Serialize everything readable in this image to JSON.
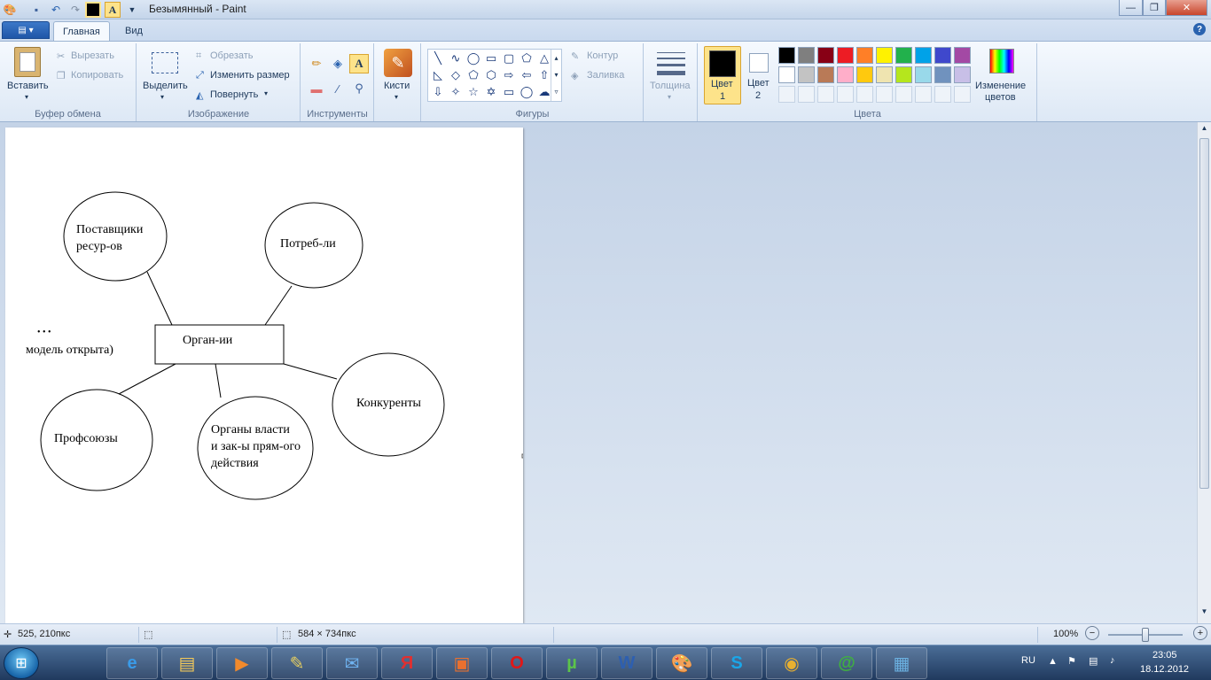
{
  "window": {
    "title": "Безымянный - Paint",
    "minimize_glyph": "—",
    "maximize_glyph": "❐",
    "close_glyph": "✕"
  },
  "tabs": [
    {
      "label": "Главная",
      "active": true
    },
    {
      "label": "Вид",
      "active": false
    }
  ],
  "ribbon": {
    "clipboard": {
      "paste_label": "Вставить",
      "cut_label": "Вырезать",
      "copy_label": "Копировать",
      "group_label": "Буфер обмена"
    },
    "image": {
      "select_label": "Выделить",
      "crop_label": "Обрезать",
      "resize_label": "Изменить размер",
      "rotate_label": "Повернуть",
      "group_label": "Изображение"
    },
    "tools": {
      "group_label": "Инструменты"
    },
    "brushes": {
      "label": "Кисти"
    },
    "shapes": {
      "outline_label": "Контур",
      "fill_label": "Заливка",
      "group_label": "Фигуры"
    },
    "size": {
      "label": "Толщина"
    },
    "colors": {
      "color1_label": "Цвет",
      "color1_num": "1",
      "color2_label": "Цвет",
      "color2_num": "2",
      "edit_label": "Изменение",
      "edit_label2": "цветов",
      "group_label": "Цвета",
      "color1": "#000000",
      "color2": "#ffffff",
      "palette_row1": [
        "#000000",
        "#7f7f7f",
        "#880015",
        "#ed1c24",
        "#ff7f27",
        "#fff200",
        "#22b14c",
        "#00a2e8",
        "#3f48cc",
        "#a349a4"
      ],
      "palette_row2": [
        "#ffffff",
        "#c3c3c3",
        "#b97a57",
        "#ffaec9",
        "#ffc90e",
        "#efe4b0",
        "#b5e61d",
        "#99d9ea",
        "#7092be",
        "#c8bfe7"
      ]
    }
  },
  "diagram": {
    "suppliers": [
      "Поставщики",
      "ресур-ов"
    ],
    "consumers": "Потреб-ли",
    "organization": "Орган-ии",
    "open_model_dots": "• • •",
    "open_model": "модель открыта)",
    "competitors": "Конкуренты",
    "unions": "Профсоюзы",
    "authorities": [
      "Органы власти",
      "и зак-ы прям-ого",
      "действия"
    ]
  },
  "statusbar": {
    "cursor_pos": "525, 210пкс",
    "image_size": "584 × 734пкс",
    "zoom": "100%"
  },
  "taskbar": {
    "apps": [
      {
        "name": "ie-icon",
        "glyph": "e",
        "color": "#3a9be8"
      },
      {
        "name": "explorer-icon",
        "glyph": "▤",
        "color": "#f1c85a"
      },
      {
        "name": "media-player-icon",
        "glyph": "▶",
        "color": "#f28a2c"
      },
      {
        "name": "paint-tool-icon",
        "glyph": "✎",
        "color": "#e8d060"
      },
      {
        "name": "mail-icon",
        "glyph": "✉",
        "color": "#6fb3f0"
      },
      {
        "name": "yandex-icon",
        "glyph": "Я",
        "color": "#e03030"
      },
      {
        "name": "briefcase-icon",
        "glyph": "▣",
        "color": "#e9702f"
      },
      {
        "name": "opera-icon",
        "glyph": "O",
        "color": "#e01818"
      },
      {
        "name": "utorrent-icon",
        "glyph": "µ",
        "color": "#5cc44a"
      },
      {
        "name": "word-icon",
        "glyph": "W",
        "color": "#2d5fb0"
      },
      {
        "name": "paint-icon",
        "glyph": "🎨",
        "color": "#f5d040"
      },
      {
        "name": "skype-icon",
        "glyph": "S",
        "color": "#1aa6e8"
      },
      {
        "name": "chrome-icon",
        "glyph": "◉",
        "color": "#e8b030"
      },
      {
        "name": "mail-agent-icon",
        "glyph": "@",
        "color": "#40b040"
      },
      {
        "name": "photo-viewer-icon",
        "glyph": "▦",
        "color": "#6bb0e0"
      }
    ],
    "lang": "RU",
    "time": "23:05",
    "date": "18.12.2012"
  }
}
